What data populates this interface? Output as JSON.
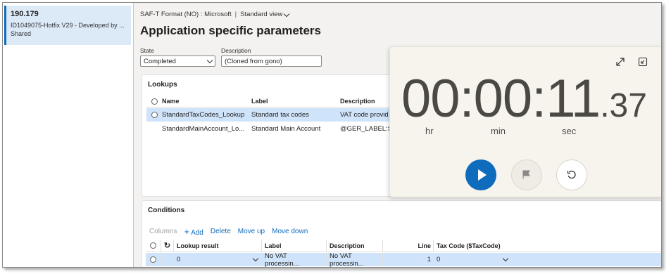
{
  "version": {
    "number": "190.179",
    "description": "ID1049075-Hotfix V29 - Developed by ...",
    "status": "Shared"
  },
  "breadcrumb": {
    "format": "SAF-T Format (NO) : Microsoft",
    "separator": "|",
    "view": "Standard view"
  },
  "page_title": "Application specific parameters",
  "state": {
    "label": "State",
    "value": "Completed"
  },
  "description_field": {
    "label": "Description",
    "value": "(Cloned from gono)"
  },
  "lookups": {
    "title": "Lookups",
    "columns": [
      "Name",
      "Label",
      "Description"
    ],
    "rows": [
      {
        "name": "StandardTaxCodes_Lookup",
        "label": "Standard tax codes",
        "description": "VAT code provid"
      },
      {
        "name": "StandardMainAccount_Lo...",
        "label": "Standard Main Account",
        "description": "@GER_LABEL:St"
      }
    ]
  },
  "conditions": {
    "title": "Conditions",
    "actions": {
      "columns": "Columns",
      "add": "Add",
      "delete": "Delete",
      "move_up": "Move up",
      "move_down": "Move down"
    },
    "columns": [
      "Lookup result",
      "Label",
      "Description",
      "Line",
      "Tax Code ($TaxCode)"
    ],
    "rows": [
      {
        "lookup_result": "0",
        "label": "No VAT processin...",
        "description": "No VAT processin...",
        "line": "1",
        "tax_code": "0"
      }
    ]
  },
  "timer": {
    "main": "00:00:11",
    "dot": ".",
    "fraction": "37",
    "units": {
      "hr": "hr",
      "min": "min",
      "sec": "sec"
    },
    "icons": [
      "expand-icon",
      "compact-overlay-icon",
      "play-icon",
      "flag-icon",
      "reset-icon"
    ]
  },
  "colors": {
    "accent": "#0f6cbd",
    "selected_row": "#cfe4fa",
    "timer_bg": "#f7f4ed"
  }
}
